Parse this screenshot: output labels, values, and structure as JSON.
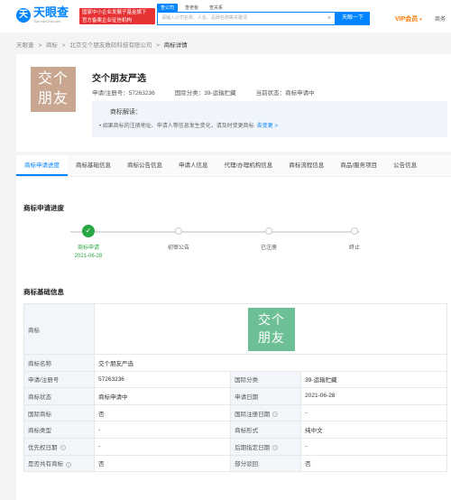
{
  "header": {
    "logo_glyph": "天",
    "logo_name": "天眼查",
    "logo_url": "TianYanCha.com",
    "slogan_line1": "国家中小企业发展子基金旗下",
    "slogan_line2": "官方备案企业征信机构",
    "search_tabs": [
      "查公司",
      "查老板",
      "查关系"
    ],
    "search_placeholder": "请输入公司名称、人名、品牌名称等关键词",
    "search_button": "天眼一下",
    "vip": "VIP会员",
    "vip_caret": "▾",
    "more": "商务"
  },
  "breadcrumb": [
    "天眼查",
    ">",
    "商标",
    ">",
    "北京交个朋友数码科技有限公司",
    ">"
  ],
  "breadcrumb_current": "商标详情",
  "mark": {
    "logo_line1": "交个",
    "logo_line2": "朋友",
    "title": "交个朋友严选",
    "reg_no": "申请/注册号：57263236",
    "intl_class": "国际分类：39-运输贮藏",
    "status": "当前状态：商标申请中",
    "interp_title": "商标解读：",
    "interp_body": "• 如果商标的注册地址、申请人等信息发生变化，请及时变更商标",
    "interp_link": "去变更 >"
  },
  "tabs": [
    "商标申请进度",
    "商标基础信息",
    "商标公告信息",
    "申请人信息",
    "代理/办理机构信息",
    "商标流程信息",
    "商品/服务项目",
    "公告信息"
  ],
  "progress": {
    "title": "商标申请进度",
    "check": "✓",
    "steps": [
      {
        "label": "商标申请",
        "date": "2021-06-28"
      },
      {
        "label": "初审公告"
      },
      {
        "label": "已注册"
      },
      {
        "label": "终止"
      }
    ]
  },
  "basic": {
    "title": "商标基础信息",
    "logo_key": "商标",
    "logo_line1": "交个",
    "logo_line2": "朋友",
    "help_icon": "?",
    "rows": [
      {
        "k1": "商标名称",
        "v1": "交个朋友严选",
        "k2": "",
        "v2": ""
      },
      {
        "k1": "申请/注册号",
        "v1": "57263236",
        "k2": "国际分类",
        "v2": "39-运输贮藏"
      },
      {
        "k1": "商标状态",
        "v1": "商标申请中",
        "k2": "申请日期",
        "v2": "2021-06-28"
      },
      {
        "k1": "国际商标",
        "v1": "否",
        "k2": "国际注册日期",
        "v2": "-"
      },
      {
        "k1": "商标类型",
        "v1": "-",
        "k2": "商标形式",
        "v2": "纯中文"
      },
      {
        "k1": "优先权日期",
        "v1": "-",
        "k2": "后期指定日期",
        "v2": "-"
      },
      {
        "k1": "是否共有商标",
        "v1": "否",
        "k2": "部分驳回",
        "v2": "否"
      }
    ]
  }
}
